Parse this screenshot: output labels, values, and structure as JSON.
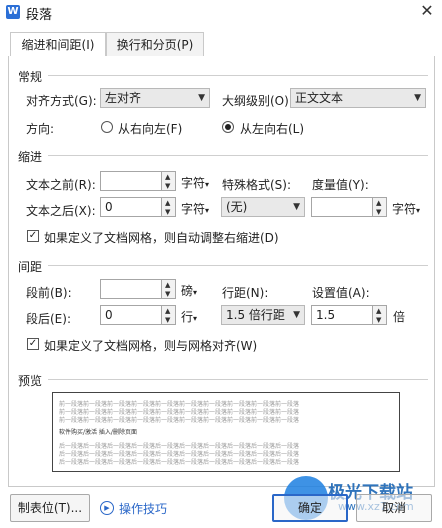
{
  "window": {
    "icon_letter": "W",
    "title": "段落",
    "close": "✕"
  },
  "tabs": [
    {
      "label": "缩进和间距(I)",
      "active": true
    },
    {
      "label": "换行和分页(P)",
      "active": false
    }
  ],
  "general": {
    "section": "常规",
    "align_label": "对齐方式(G):",
    "align_value": "左对齐",
    "outline_label": "大纲级别(O):",
    "outline_value": "正文文本",
    "direction_label": "方向:",
    "rtl_label": "从右向左(F)",
    "ltr_label": "从左向右(L)"
  },
  "indent": {
    "section": "缩进",
    "before_label": "文本之前(R):",
    "before_value": "",
    "before_unit": "字符",
    "special_label": "特殊格式(S):",
    "special_value": "(无)",
    "measure_label": "度量值(Y):",
    "measure_value": "",
    "measure_unit": "字符",
    "after_label": "文本之后(X):",
    "after_value": "0",
    "after_unit": "字符",
    "auto_adjust_label": "如果定义了文档网格，则自动调整右缩进(D)"
  },
  "spacing": {
    "section": "间距",
    "before_label": "段前(B):",
    "before_value": "",
    "before_unit": "磅",
    "line_label": "行距(N):",
    "line_value": "1.5 倍行距",
    "set_label": "设置值(A):",
    "set_value": "1.5",
    "set_unit": "倍",
    "after_label": "段后(E):",
    "after_value": "0",
    "after_unit": "行",
    "snap_label": "如果定义了文档网格，则与网格对齐(W)"
  },
  "preview": {
    "section": "预览",
    "prev_text": "前一段落前一段落前一段落前一段落前一段落前一段落前一段落前一段落前一段落前一段落",
    "sample_text": "软件购买/激活 插入/删除页面",
    "next_text": "后一段落后一段落后一段落后一段落后一段落后一段落后一段落后一段落后一段落后一段落"
  },
  "footer": {
    "tabs_button": "制表位(T)...",
    "tips_icon": "▶",
    "tips_label": "操作技巧",
    "ok_button": "确定",
    "cancel_button": "取消"
  },
  "watermark": {
    "brand": "极光下载站",
    "url": "www.xz7.com"
  },
  "icons": {
    "dropdown": "chevron-down-icon",
    "spin_up": "▲",
    "spin_down": "▼",
    "check": "✓"
  },
  "colors": {
    "accent": "#2a67c8",
    "watermark": "#1a66b5"
  }
}
